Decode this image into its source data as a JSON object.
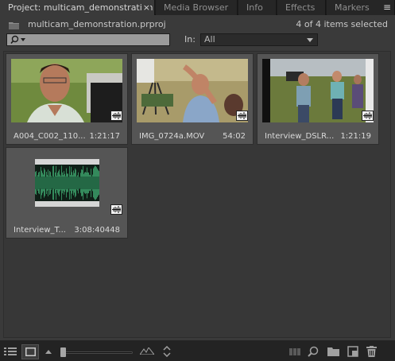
{
  "tabs": [
    {
      "label": "Project: multicam_demonstration",
      "active": true,
      "close": "×"
    },
    {
      "label": "Media Browser",
      "active": false
    },
    {
      "label": "Info",
      "active": false
    },
    {
      "label": "Effects",
      "active": false
    },
    {
      "label": "Markers",
      "active": false
    }
  ],
  "tab_menu_icon": "≡",
  "project": {
    "file": "multicam_demonstration.prproj",
    "items_count": "4 of 4 items selected"
  },
  "filter": {
    "search_value": "",
    "in_label": "In:",
    "in_value": "All"
  },
  "clips": [
    {
      "name": "A004_C002_110...",
      "duration": "1:21:17",
      "type": "video"
    },
    {
      "name": "IMG_0724a.MOV",
      "duration": "54:02",
      "type": "video"
    },
    {
      "name": "Interview_DSLR...",
      "duration": "1:21:19",
      "type": "video"
    },
    {
      "name": "Interview_T...",
      "duration": "3:08:40448",
      "type": "audio"
    }
  ],
  "toolbar": {
    "icons": [
      "list-view-icon",
      "icon-view-icon",
      "zoom-out-icon",
      "zoom-in-icon",
      "sort-icon",
      "automate-to-sequence-icon",
      "find-icon",
      "new-bin-icon",
      "new-item-icon",
      "trash-icon"
    ]
  },
  "zoom_level": 0.0,
  "colors": {
    "panel": "#3a3a3a",
    "tile": "#555555",
    "search_bg": "#9b9b9b",
    "audio_wave": "#3ea56f"
  }
}
